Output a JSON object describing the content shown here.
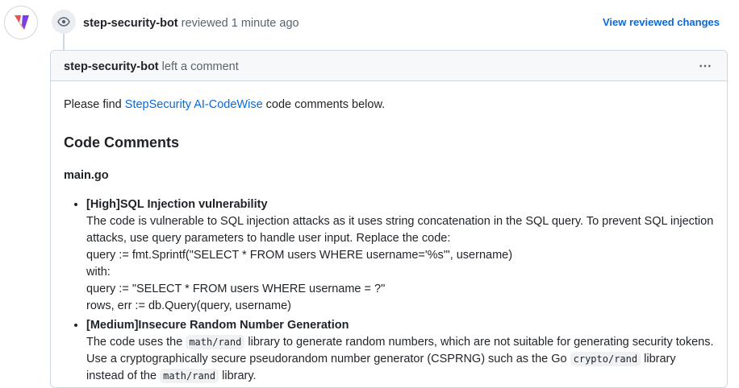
{
  "review": {
    "author": "step-security-bot",
    "action": "reviewed",
    "time": "1 minute ago",
    "view_changes_label": "View reviewed changes"
  },
  "comment": {
    "author": "step-security-bot",
    "action": "left a comment",
    "kebab_icon": "⋯",
    "intro_before": "Please find ",
    "intro_link": "StepSecurity AI-CodeWise",
    "intro_after": " code comments below.",
    "heading": "Code Comments",
    "file": "main.go",
    "items": [
      {
        "title": "[High]SQL Injection vulnerability",
        "lines": [
          "The code is vulnerable to SQL injection attacks as it uses string concatenation in the SQL query. To prevent SQL injection attacks, use query parameters to handle user input. Replace the code:",
          "query := fmt.Sprintf(\"SELECT * FROM users WHERE username='%s'\", username)",
          "with:",
          "query := \"SELECT * FROM users WHERE username = ?\"",
          "rows, err := db.Query(query, username)"
        ]
      },
      {
        "title": "[Medium]Insecure Random Number Generation",
        "text_1": "The code uses the ",
        "code_1": "math/rand",
        "text_2": " library to generate random numbers, which are not suitable for generating security tokens. Use a cryptographically secure pseudorandom number generator (CSPRNG) such as the Go ",
        "code_2": "crypto/rand",
        "text_3": " library instead of the ",
        "code_3": "math/rand",
        "text_4": " library."
      }
    ]
  },
  "colors": {
    "link": "#0969da",
    "border": "#d0d7de",
    "header_bg": "#f6f8fa",
    "muted": "#59636e",
    "logo_red": "#e8514f",
    "logo_purple": "#7b3fe4"
  }
}
